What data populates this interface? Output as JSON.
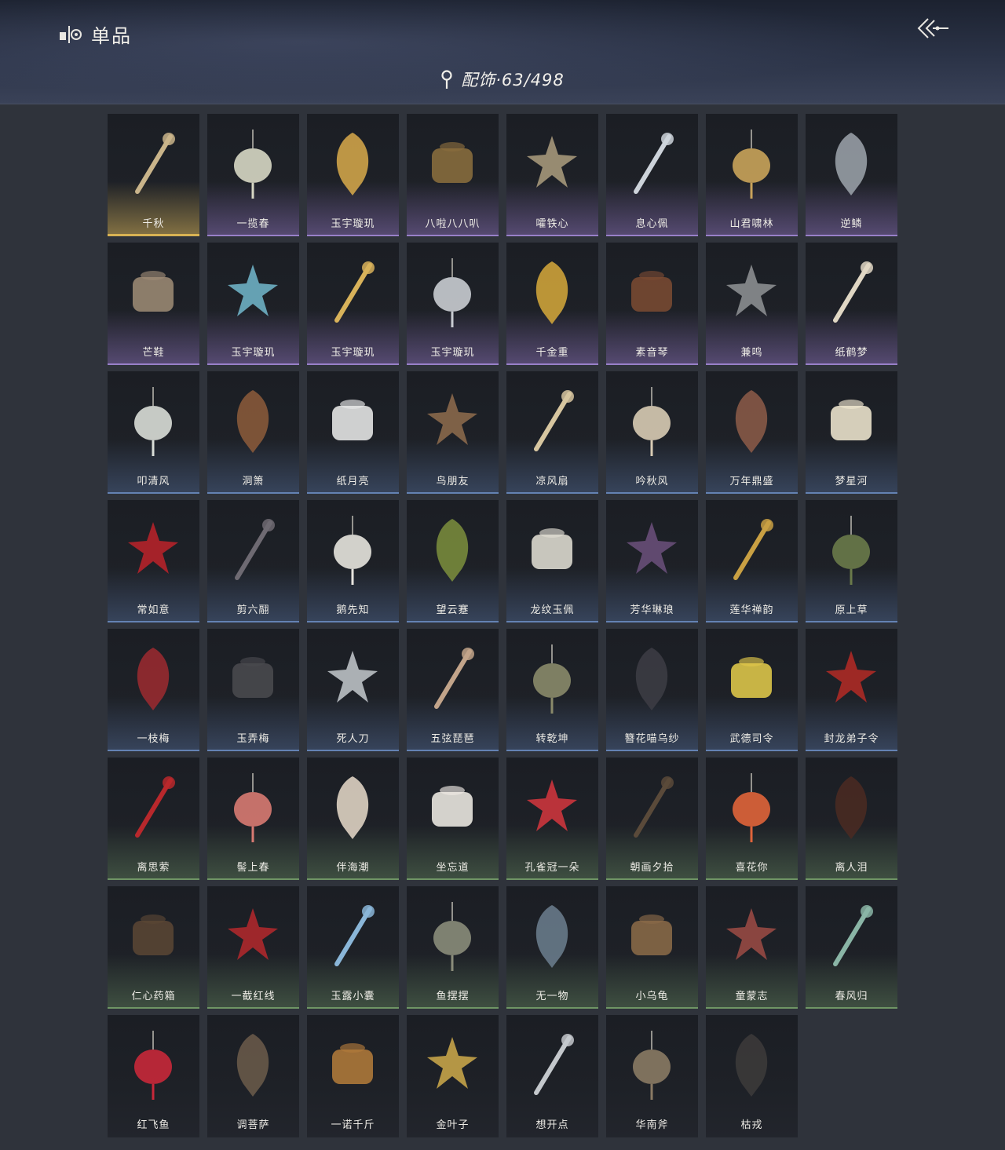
{
  "header": {
    "title": "单品",
    "category": "配饰·63/498"
  },
  "items": [
    {
      "name": "千秋",
      "tier": "gold",
      "color": "#c9b48a",
      "icon": "fan-guqin-icon"
    },
    {
      "name": "一揽春",
      "tier": "purple",
      "color": "#d7d7c4",
      "icon": "flower-basket-icon"
    },
    {
      "name": "玉宇璇玑",
      "tier": "purple",
      "color": "#d4a64a",
      "icon": "ornament-icon"
    },
    {
      "name": "八啦八八叭",
      "tier": "purple",
      "color": "#8a6d3e",
      "icon": "pot-icon"
    },
    {
      "name": "嚯铁心",
      "tier": "purple",
      "color": "#a89a7c",
      "icon": "blade-icon"
    },
    {
      "name": "息心佩",
      "tier": "purple",
      "color": "#cdd3da",
      "icon": "pendant-icon"
    },
    {
      "name": "山君啸林",
      "tier": "purple",
      "color": "#c9a35a",
      "icon": "medallion-icon"
    },
    {
      "name": "逆鳞",
      "tier": "purple",
      "color": "#9aa0a8",
      "icon": "dagger-icon"
    },
    {
      "name": "芒鞋",
      "tier": "purple",
      "color": "#9c8a74",
      "icon": "sandals-icon"
    },
    {
      "name": "玉宇璇玑",
      "tier": "purple",
      "color": "#6fb3c7",
      "icon": "hairpin-icon"
    },
    {
      "name": "玉宇璇玑",
      "tier": "purple",
      "color": "#d8b25a",
      "icon": "gourd-pendant-icon"
    },
    {
      "name": "玉宇璇玑",
      "tier": "purple",
      "color": "#c9ccd2",
      "icon": "tassel-icon"
    },
    {
      "name": "千金重",
      "tier": "purple",
      "color": "#d2a53a",
      "icon": "golden-bird-icon"
    },
    {
      "name": "素音琴",
      "tier": "purple",
      "color": "#7a4a32",
      "icon": "guqin-icon"
    },
    {
      "name": "兼鸣",
      "tier": "purple",
      "color": "#8d8f93",
      "icon": "shield-ornament-icon"
    },
    {
      "name": "纸鹤梦",
      "tier": "purple",
      "color": "#e0d7c4",
      "icon": "paper-crane-icon"
    },
    {
      "name": "叩清风",
      "tier": "blue",
      "color": "#d9ddd7",
      "icon": "round-fan-icon"
    },
    {
      "name": "洞箫",
      "tier": "blue",
      "color": "#8a5a3a",
      "icon": "flute-icon"
    },
    {
      "name": "纸月亮",
      "tier": "blue",
      "color": "#e8e8e8",
      "icon": "paper-moon-icon"
    },
    {
      "name": "鸟朋友",
      "tier": "blue",
      "color": "#8c6a4c",
      "icon": "bird-house-icon"
    },
    {
      "name": "凉风扇",
      "tier": "blue",
      "color": "#d7c6a0",
      "icon": "silk-fan-icon"
    },
    {
      "name": "吟秋风",
      "tier": "blue",
      "color": "#d8cbb4",
      "icon": "leaf-fan-icon"
    },
    {
      "name": "万年鼎盛",
      "tier": "blue",
      "color": "#8a5a48",
      "icon": "cauldron-icon"
    },
    {
      "name": "梦星河",
      "tier": "blue",
      "color": "#efe6cf",
      "icon": "flower-tray-icon"
    },
    {
      "name": "常如意",
      "tier": "blue",
      "color": "#b8222a",
      "icon": "knot-pendant-icon"
    },
    {
      "name": "剪六翮",
      "tier": "blue",
      "color": "#6e6a72",
      "icon": "short-sword-icon"
    },
    {
      "name": "鹅先知",
      "tier": "blue",
      "color": "#e7e4de",
      "icon": "goose-icon"
    },
    {
      "name": "望云蹇",
      "tier": "blue",
      "color": "#7a8c3c",
      "icon": "bamboo-flute-icon"
    },
    {
      "name": "龙纹玉佩",
      "tier": "blue",
      "color": "#e0ddd3",
      "icon": "jade-pendant-icon"
    },
    {
      "name": "芳华琳琅",
      "tier": "blue",
      "color": "#6a4f7a",
      "icon": "flower-string-icon"
    },
    {
      "name": "莲华禅韵",
      "tier": "blue",
      "color": "#c9a043",
      "icon": "gold-lotus-icon"
    },
    {
      "name": "原上草",
      "tier": "blue",
      "color": "#6a7a4a",
      "icon": "grass-basket-icon"
    },
    {
      "name": "一枝梅",
      "tier": "blue",
      "color": "#9a2a30",
      "icon": "plum-branch-icon"
    },
    {
      "name": "玉弄梅",
      "tier": "blue",
      "color": "#4a4a4e",
      "icon": "scroll-case-icon"
    },
    {
      "name": "死人刀",
      "tier": "blue",
      "color": "#bfc4c8",
      "icon": "saber-icon"
    },
    {
      "name": "五弦琵琶",
      "tier": "blue",
      "color": "#c2a48a",
      "icon": "pipa-icon"
    },
    {
      "name": "转乾坤",
      "tier": "blue",
      "color": "#8a8a6a",
      "icon": "compass-pendant-icon"
    },
    {
      "name": "簪花喵乌纱",
      "tier": "blue",
      "color": "#3c3c44",
      "icon": "hat-icon"
    },
    {
      "name": "武德司令",
      "tier": "blue",
      "color": "#e0c84a",
      "icon": "token-icon"
    },
    {
      "name": "封龙弟子令",
      "tier": "blue",
      "color": "#b02a26",
      "icon": "rod-token-icon"
    },
    {
      "name": "离思萦",
      "tier": "green",
      "color": "#b8282c",
      "icon": "necklace-icon"
    },
    {
      "name": "髻上春",
      "tier": "green",
      "color": "#d87a72",
      "icon": "peony-icon"
    },
    {
      "name": "伴海潮",
      "tier": "green",
      "color": "#e3d6c6",
      "icon": "starfish-icon"
    },
    {
      "name": "坐忘道",
      "tier": "green",
      "color": "#eeeae4",
      "icon": "mask-icon"
    },
    {
      "name": "孔雀冠一朵",
      "tier": "green",
      "color": "#d0353d",
      "icon": "red-flower-icon"
    },
    {
      "name": "朝画夕拾",
      "tier": "green",
      "color": "#5a4a3a",
      "icon": "brush-icon"
    },
    {
      "name": "喜花你",
      "tier": "green",
      "color": "#e0643a",
      "icon": "orange-flower-icon"
    },
    {
      "name": "离人泪",
      "tier": "green",
      "color": "#4a2a22",
      "icon": "wine-jar-icon"
    },
    {
      "name": "仁心药箱",
      "tier": "green",
      "color": "#5a4634",
      "icon": "medicine-box-icon"
    },
    {
      "name": "一截红线",
      "tier": "green",
      "color": "#b0282c",
      "icon": "red-bracelet-icon"
    },
    {
      "name": "玉露小囊",
      "tier": "green",
      "color": "#8ab6d8",
      "icon": "pouch-icon"
    },
    {
      "name": "鱼摆摆",
      "tier": "green",
      "color": "#8a8c7a",
      "icon": "fish-icon"
    },
    {
      "name": "无一物",
      "tier": "green",
      "color": "#6a7c8c",
      "icon": "cloth-bag-icon"
    },
    {
      "name": "小乌龟",
      "tier": "green",
      "color": "#8a6a48",
      "icon": "turtle-icon"
    },
    {
      "name": "童蒙志",
      "tier": "green",
      "color": "#9a4a44",
      "icon": "banner-icon"
    },
    {
      "name": "春风归",
      "tier": "green",
      "color": "#8ab5a6",
      "icon": "kite-swallow-icon"
    },
    {
      "name": "红飞鱼",
      "tier": "plain",
      "color": "#c8283a",
      "icon": "kite-fish-icon"
    },
    {
      "name": "调菩萨",
      "tier": "plain",
      "color": "#6a5a4a",
      "icon": "daggers-icon"
    },
    {
      "name": "一诺千斤",
      "tier": "plain",
      "color": "#b07a3a",
      "icon": "roast-duck-icon"
    },
    {
      "name": "金叶子",
      "tier": "plain",
      "color": "#c9a64a",
      "icon": "gold-leaf-icon"
    },
    {
      "name": "想开点",
      "tier": "plain",
      "color": "#c4c8cc",
      "icon": "knife-icon"
    },
    {
      "name": "华南斧",
      "tier": "plain",
      "color": "#8a7a64",
      "icon": "axe-icon"
    },
    {
      "name": "枯戎",
      "tier": "plain",
      "color": "#3c3a3a",
      "icon": "branch-icon"
    }
  ]
}
